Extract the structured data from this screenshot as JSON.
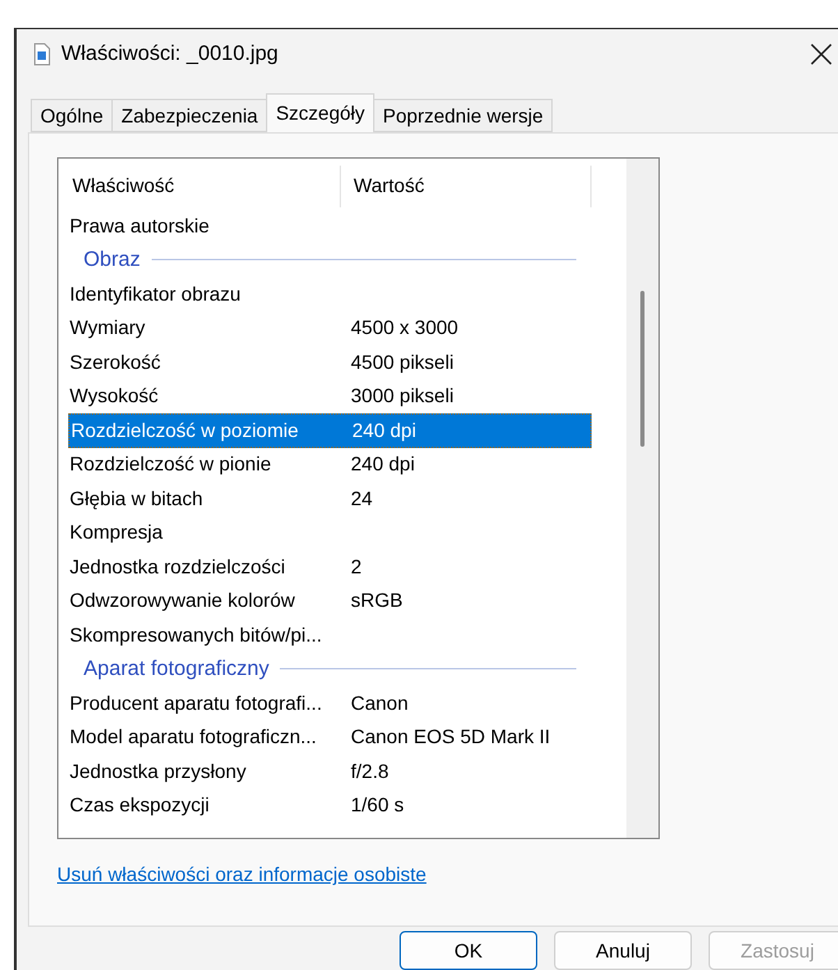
{
  "window": {
    "title": "Właściwości: _0010.jpg"
  },
  "tabs": [
    {
      "label": "Ogólne",
      "selected": false
    },
    {
      "label": "Zabezpieczenia",
      "selected": false
    },
    {
      "label": "Szczegóły",
      "selected": true
    },
    {
      "label": "Poprzednie wersje",
      "selected": false
    }
  ],
  "table": {
    "columns": [
      "Właściwość",
      "Wartość"
    ],
    "rows": [
      {
        "kind": "property",
        "name": "Prawa autorskie",
        "value": "",
        "selected": false
      },
      {
        "kind": "group",
        "name": "Obraz"
      },
      {
        "kind": "property",
        "name": "Identyfikator obrazu",
        "value": "",
        "selected": false
      },
      {
        "kind": "property",
        "name": "Wymiary",
        "value": "4500 x 3000",
        "selected": false
      },
      {
        "kind": "property",
        "name": "Szerokość",
        "value": "4500 pikseli",
        "selected": false
      },
      {
        "kind": "property",
        "name": "Wysokość",
        "value": "3000 pikseli",
        "selected": false
      },
      {
        "kind": "property",
        "name": "Rozdzielczość w poziomie",
        "value": "240 dpi",
        "selected": true
      },
      {
        "kind": "property",
        "name": "Rozdzielczość w pionie",
        "value": "240 dpi",
        "selected": false
      },
      {
        "kind": "property",
        "name": "Głębia w bitach",
        "value": "24",
        "selected": false
      },
      {
        "kind": "property",
        "name": "Kompresja",
        "value": "",
        "selected": false
      },
      {
        "kind": "property",
        "name": "Jednostka rozdzielczości",
        "value": "2",
        "selected": false
      },
      {
        "kind": "property",
        "name": "Odwzorowywanie kolorów",
        "value": "sRGB",
        "selected": false
      },
      {
        "kind": "property",
        "name": "Skompresowanych bitów/pi...",
        "value": "",
        "selected": false
      },
      {
        "kind": "group",
        "name": "Aparat fotograficzny"
      },
      {
        "kind": "property",
        "name": "Producent aparatu fotografi...",
        "value": "Canon",
        "selected": false
      },
      {
        "kind": "property",
        "name": "Model aparatu fotograficzn...",
        "value": "Canon EOS 5D Mark II",
        "selected": false
      },
      {
        "kind": "property",
        "name": "Jednostka przysłony",
        "value": "f/2.8",
        "selected": false
      },
      {
        "kind": "property",
        "name": "Czas ekspozycji",
        "value": "1/60 s",
        "selected": false
      }
    ]
  },
  "link": "Usuń właściwości oraz informacje osobiste",
  "buttons": [
    {
      "label": "OK",
      "kind": "default",
      "disabled": false
    },
    {
      "label": "Anuluj",
      "kind": "normal",
      "disabled": false
    },
    {
      "label": "Zastosuj",
      "kind": "normal",
      "disabled": true
    }
  ]
}
